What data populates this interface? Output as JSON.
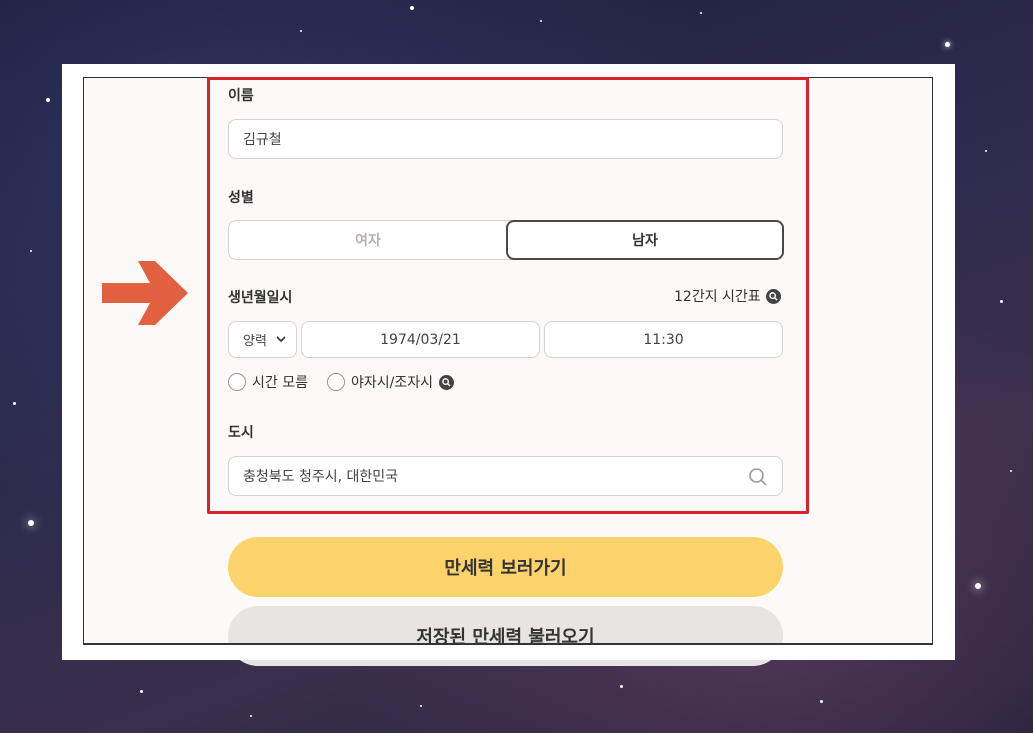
{
  "form": {
    "name": {
      "label": "이름",
      "value": "김규철"
    },
    "gender": {
      "label": "성별",
      "options": [
        "여자",
        "남자"
      ],
      "selected": "남자"
    },
    "birth": {
      "label": "생년월일시",
      "timetable_link": "12간지 시간표",
      "calendar_type": "양력",
      "date": "1974/03/21",
      "time": "11:30",
      "unknown_time_label": "시간 모름",
      "night_time_label": "야자시/조자시"
    },
    "city": {
      "label": "도시",
      "value": "충청북도 청주시, 대한민국"
    }
  },
  "buttons": {
    "primary": "만세력 보러가기",
    "secondary": "저장된 만세력 불러오기"
  },
  "colors": {
    "highlight": "#d9222c",
    "arrow": "#e2603f",
    "primary_button": "#fdd36b",
    "secondary_button": "#e6e5e3"
  },
  "icons": {
    "search": "search-icon",
    "magnifier_badge": "magnifier-badge-icon",
    "chevron": "chevron-down-icon",
    "arrow": "arrow-right-icon"
  }
}
